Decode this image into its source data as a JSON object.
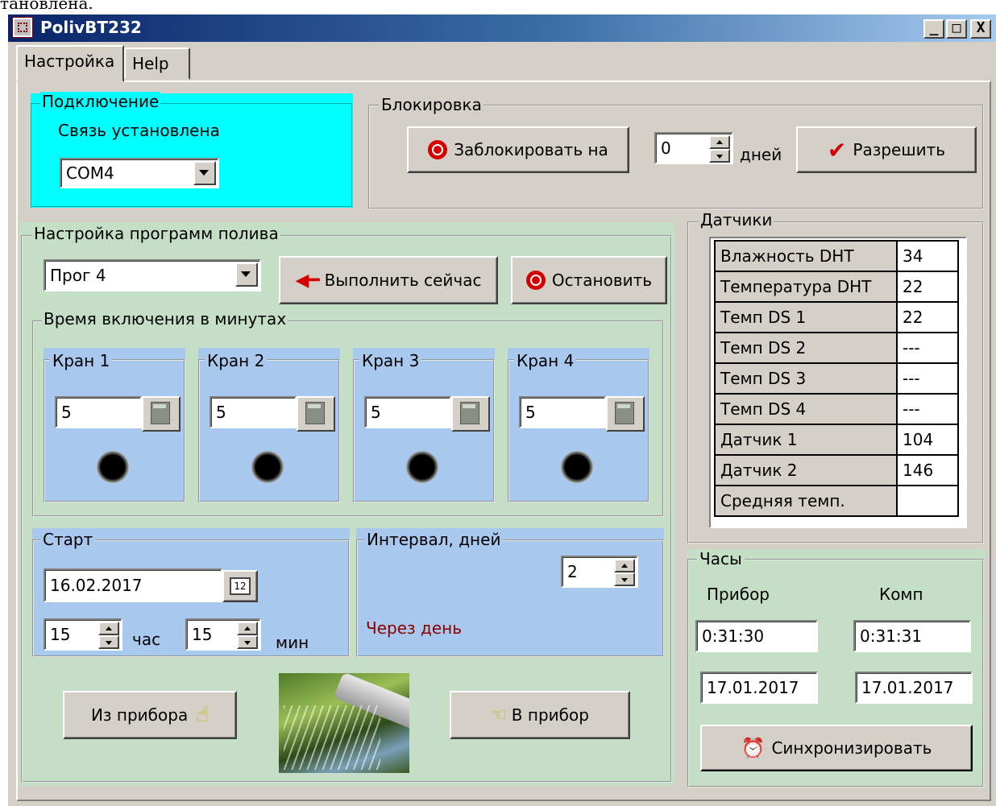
{
  "top_cut_text": "тановлена.",
  "window": {
    "title": "PolivBT232",
    "btn_min": "_",
    "btn_max": "□",
    "btn_close": "X"
  },
  "tabs": [
    {
      "label": "Настройка"
    },
    {
      "label": "Help"
    }
  ],
  "connection": {
    "title": "Подключение",
    "status": "Связь установлена",
    "port": "COM4",
    "bg_color": "#00ffff"
  },
  "lock": {
    "title": "Блокировка",
    "lock_button": "Заблокировать на",
    "days_value": "0",
    "days_label": "дней",
    "allow_button": "Разрешить"
  },
  "programs": {
    "title": "Настройка программ полива",
    "selected": "Прог 4",
    "run_now": "Выполнить сейчас",
    "stop": "Остановить",
    "time_group": "Время включения в минутах",
    "valves": [
      {
        "label": "Кран 1",
        "value": "5"
      },
      {
        "label": "Кран 2",
        "value": "5"
      },
      {
        "label": "Кран 3",
        "value": "5"
      },
      {
        "label": "Кран 4",
        "value": "5"
      }
    ],
    "start": {
      "title": "Старт",
      "date": "16.02.2017",
      "hour": "15",
      "hour_label": "час",
      "min": "15",
      "min_label": "мин",
      "calendar_day": "12"
    },
    "interval": {
      "title": "Интервал, дней",
      "value": "2",
      "text": "Через день"
    },
    "from_device": "Из прибора",
    "to_device": "В прибор",
    "panel_color": "#c4dfc5",
    "subpanel_color": "#a9c8ed"
  },
  "sensors": {
    "title": "Датчики",
    "rows": [
      {
        "name": "Влажность DHT",
        "value": "34"
      },
      {
        "name": "Температура DHT",
        "value": "22"
      },
      {
        "name": "Темп DS 1",
        "value": "22"
      },
      {
        "name": "Темп DS 2",
        "value": "---"
      },
      {
        "name": "Темп DS 3",
        "value": "---"
      },
      {
        "name": "Темп DS 4",
        "value": "---"
      },
      {
        "name": "Датчик 1",
        "value": "104"
      },
      {
        "name": "Датчик 2",
        "value": "146"
      },
      {
        "name": "Средняя темп.",
        "value": ""
      }
    ]
  },
  "clock": {
    "title": "Часы",
    "device_label": "Прибор",
    "pc_label": "Комп",
    "device_time": "0:31:30",
    "pc_time": "0:31:31",
    "device_date": "17.01.2017",
    "pc_date": "17.01.2017",
    "sync_button": "Синхронизировать"
  }
}
